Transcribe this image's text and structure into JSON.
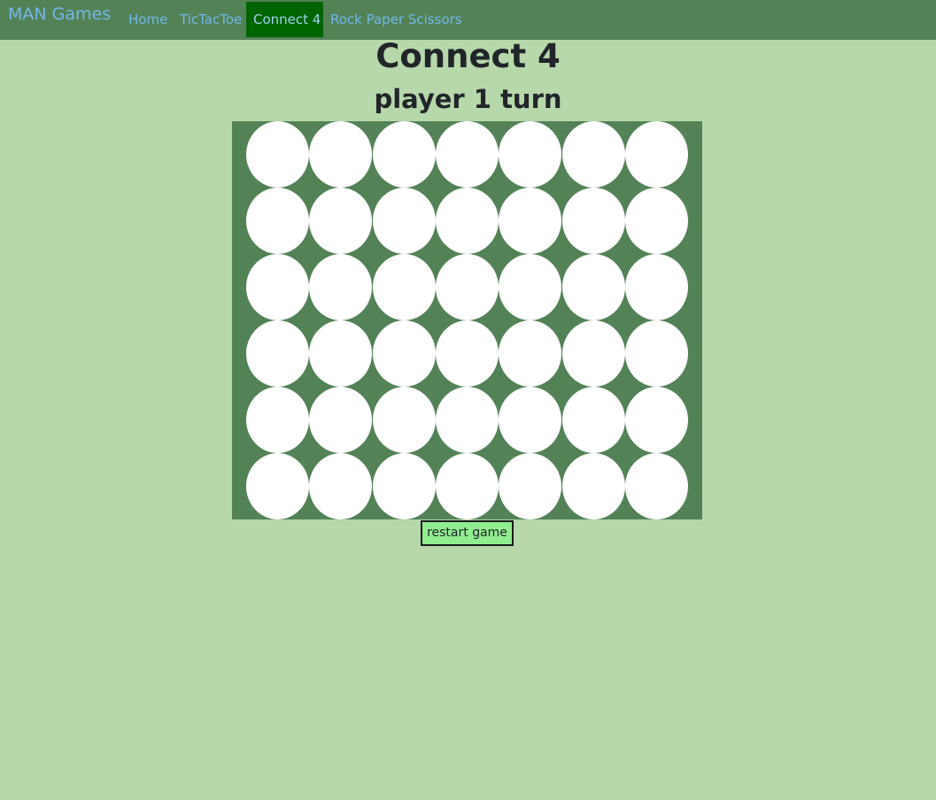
{
  "navbar": {
    "brand": "MAN Games",
    "items": [
      {
        "label": "Home",
        "active": false
      },
      {
        "label": "TicTacToe",
        "active": false
      },
      {
        "label": "Connect 4",
        "active": true
      },
      {
        "label": "Rock Paper Scissors",
        "active": false
      }
    ]
  },
  "game": {
    "title": "Connect 4",
    "status": "player 1 turn",
    "rows": 6,
    "columns": 7,
    "restart_label": "restart game"
  },
  "colors": {
    "background": "#b6d8aa",
    "navbar": "#538257",
    "active_nav": "#006400",
    "board": "#538257",
    "empty_cell": "#ffffff",
    "restart_button": "#90ee90",
    "link": "#72b8e8"
  }
}
